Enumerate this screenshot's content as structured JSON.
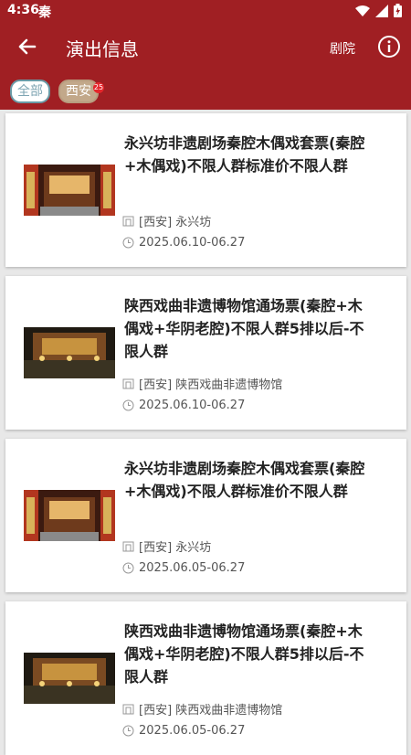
{
  "status": {
    "time": "4:36",
    "carrier": "秦"
  },
  "header": {
    "title": "演出信息",
    "theater_label": "剧院"
  },
  "filters": {
    "all": "全部",
    "city": "西安",
    "city_badge": "25"
  },
  "cards": [
    {
      "title": "永兴坊非遗剧场秦腔木偶戏套票(秦腔+木偶戏)不限人群标准价不限人群",
      "venue": "[西安] 永兴坊",
      "dates": "2025.06.10-06.27"
    },
    {
      "title": "陕西戏曲非遗博物馆通场票(秦腔+木偶戏+华阴老腔)不限人群5排以后-不限人群",
      "venue": "[西安] 陕西戏曲非遗博物馆",
      "dates": "2025.06.10-06.27"
    },
    {
      "title": "永兴坊非遗剧场秦腔木偶戏套票(秦腔+木偶戏)不限人群标准价不限人群",
      "venue": "[西安] 永兴坊",
      "dates": "2025.06.05-06.27"
    },
    {
      "title": "陕西戏曲非遗博物馆通场票(秦腔+木偶戏+华阴老腔)不限人群5排以后-不限人群",
      "venue": "[西安] 陕西戏曲非遗博物馆",
      "dates": "2025.06.05-06.27"
    }
  ]
}
